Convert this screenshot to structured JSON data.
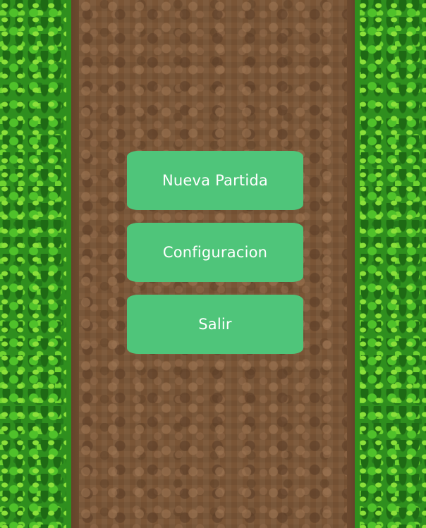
{
  "menu": {
    "items": [
      {
        "label": "Nueva Partida"
      },
      {
        "label": "Configuracion"
      },
      {
        "label": "Salir"
      }
    ]
  },
  "colors": {
    "button": "#4fc57a",
    "button_text": "#ffffff",
    "grass": "#2f8f1e",
    "dirt": "#7a5536"
  }
}
